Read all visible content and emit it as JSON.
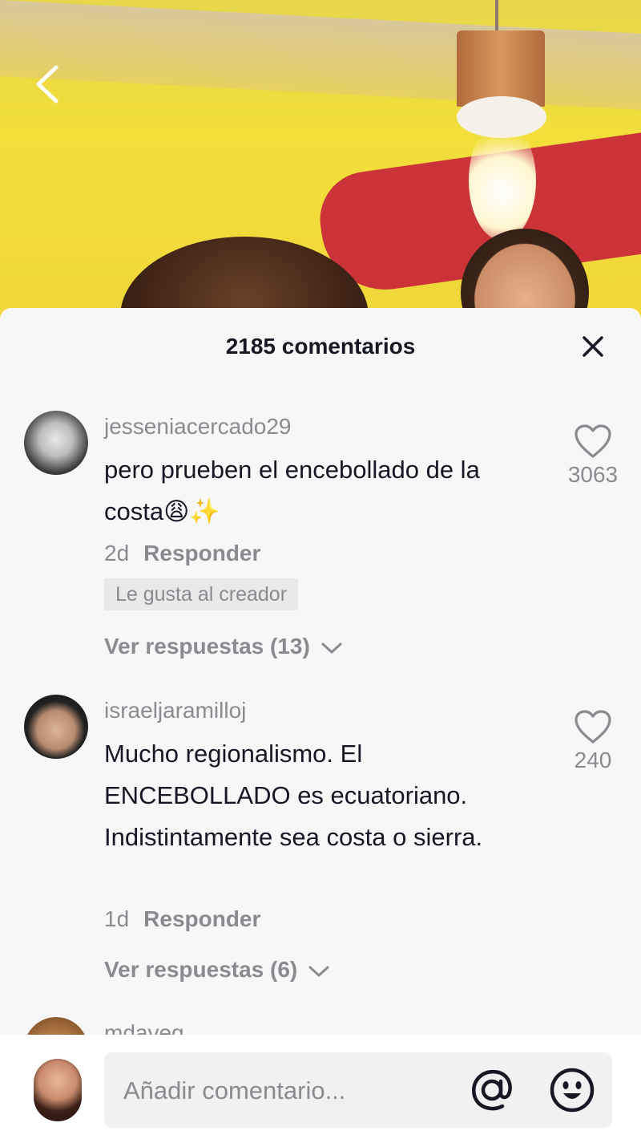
{
  "header": {
    "comment_count_label": "2185 comentarios"
  },
  "comments": [
    {
      "username": "jesseniacercado29",
      "text": "pero prueben el encebollado de la costa😩✨",
      "age": "2d",
      "reply_label": "Responder",
      "creator_badge": "Le gusta al creador",
      "view_replies": "Ver respuestas (13)",
      "likes": "3063"
    },
    {
      "username": "israeljaramilloj",
      "text": "Mucho regionalismo. El ENCEBOLLADO es ecuatoriano. Indistintamente sea costa o sierra.",
      "age": "1d",
      "reply_label": "Responder",
      "view_replies": "Ver respuestas (6)",
      "likes": "240"
    },
    {
      "username": "mdaveg"
    }
  ],
  "composer": {
    "placeholder": "Añadir comentario..."
  },
  "icons": {
    "back": "chevron-left-icon",
    "close": "close-icon",
    "like": "heart-outline-icon",
    "mention": "at-sign-icon",
    "emoji": "smiley-icon"
  },
  "colors": {
    "sheet_background": "#f7f7f7",
    "primary_text": "#161823",
    "secondary_text": "#8a8b91"
  }
}
